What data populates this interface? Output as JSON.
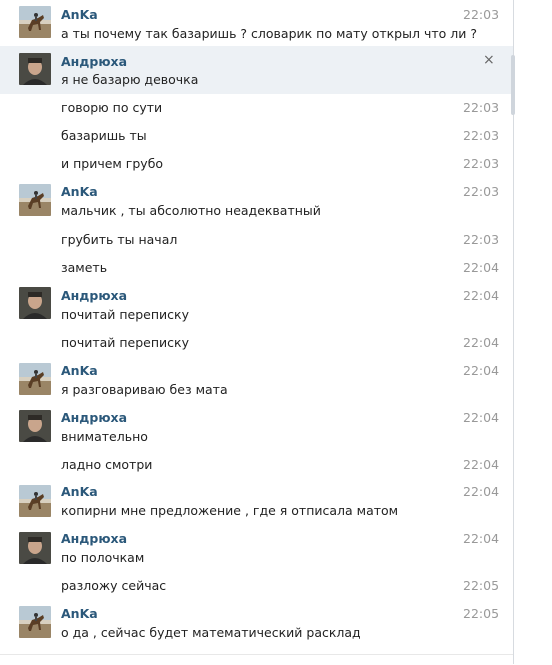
{
  "messages": [
    {
      "type": "head",
      "author": "AnKa",
      "avatar": "horse",
      "text": "а ты почему так базаришь ? словарик по мату открыл что ли ?",
      "time": "22:03"
    },
    {
      "type": "head",
      "author": "Андрюха",
      "avatar": "man",
      "text": "я не базарю девочка",
      "time": "",
      "highlight": true,
      "close": "×"
    },
    {
      "type": "cont",
      "text": "говорю по сути",
      "time": "22:03"
    },
    {
      "type": "cont",
      "text": "базаришь ты",
      "time": "22:03"
    },
    {
      "type": "cont",
      "text": "и причем грубо",
      "time": "22:03"
    },
    {
      "type": "head",
      "author": "AnKa",
      "avatar": "horse",
      "text": "мальчик , ты абсолютно неадекватный",
      "time": "22:03"
    },
    {
      "type": "cont",
      "text": "грубить ты начал",
      "time": "22:03"
    },
    {
      "type": "cont",
      "text": "заметь",
      "time": "22:04"
    },
    {
      "type": "head",
      "author": "Андрюха",
      "avatar": "man",
      "text": "почитай переписку",
      "time": "22:04"
    },
    {
      "type": "cont",
      "text": "почитай переписку",
      "time": "22:04"
    },
    {
      "type": "head",
      "author": "AnKa",
      "avatar": "horse",
      "text": "я разговариваю без мата",
      "time": "22:04"
    },
    {
      "type": "head",
      "author": "Андрюха",
      "avatar": "man",
      "text": "внимательно",
      "time": "22:04"
    },
    {
      "type": "cont",
      "text": "ладно смотри",
      "time": "22:04"
    },
    {
      "type": "head",
      "author": "AnKa",
      "avatar": "horse",
      "text": "копирни мне предложение , где я отписала матом",
      "time": "22:04"
    },
    {
      "type": "head",
      "author": "Андрюха",
      "avatar": "man",
      "text": "по полочкам",
      "time": "22:04"
    },
    {
      "type": "cont",
      "text": "разложу сейчас",
      "time": "22:05"
    },
    {
      "type": "head",
      "author": "AnKa",
      "avatar": "horse",
      "text": "о да , сейчас будет математический расклад",
      "time": "22:05"
    }
  ],
  "colors": {
    "author": "#2b587a",
    "time": "#999999",
    "highlight": "#edf1f5"
  }
}
